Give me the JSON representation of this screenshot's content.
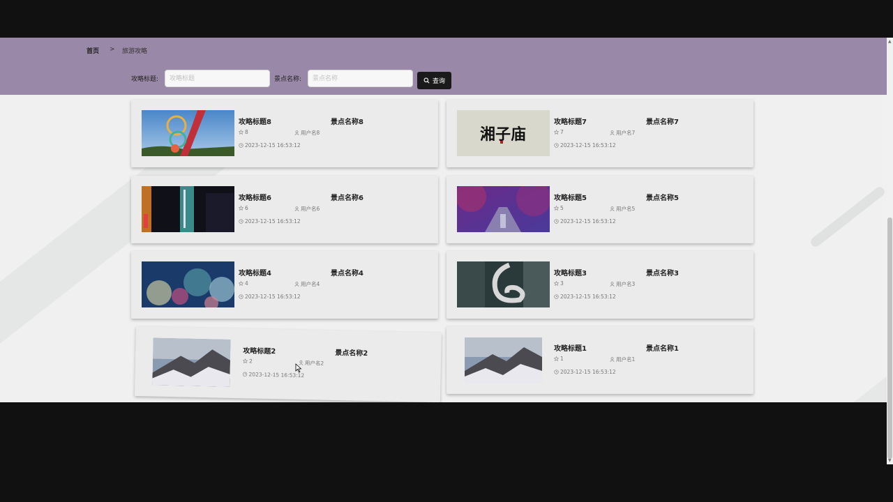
{
  "breadcrumb": {
    "home": "首页",
    "separator": ">",
    "current": "旅游攻略"
  },
  "filters": {
    "title_label": "攻略标题:",
    "title_placeholder": "攻略标题",
    "spot_label": "景点名称:",
    "spot_placeholder": "景点名称",
    "query_label": "查询",
    "query_icon": "search-icon"
  },
  "cards": [
    {
      "title": "攻略标题8",
      "spot": "景点名称8",
      "likes": "8",
      "user": "用户名8",
      "time": "2023-12-15 16:53:12",
      "image": "ferris-wheel-photo"
    },
    {
      "title": "攻略标题7",
      "spot": "景点名称7",
      "likes": "7",
      "user": "用户名7",
      "time": "2023-12-15 16:53:12",
      "image": "calligraphy-photo"
    },
    {
      "title": "攻略标题6",
      "spot": "景点名称6",
      "likes": "6",
      "user": "用户名6",
      "time": "2023-12-15 16:53:12",
      "image": "night-street-photo"
    },
    {
      "title": "攻略标题5",
      "spot": "景点名称5",
      "likes": "5",
      "user": "用户名5",
      "time": "2023-12-15 16:53:12",
      "image": "blossom-path-photo"
    },
    {
      "title": "攻略标题4",
      "spot": "景点名称4",
      "likes": "4",
      "user": "用户名4",
      "time": "2023-12-15 16:53:12",
      "image": "underwater-coral-photo"
    },
    {
      "title": "攻略标题3",
      "spot": "景点名称3",
      "likes": "3",
      "user": "用户名3",
      "time": "2023-12-15 16:53:12",
      "image": "metal-sculpture-photo"
    },
    {
      "title": "攻略标题2",
      "spot": "景点名称2",
      "likes": "2",
      "user": "用户名2",
      "time": "2023-12-15 16:53:12",
      "image": "snow-mountain-photo"
    },
    {
      "title": "攻略标题1",
      "spot": "景点名称1",
      "likes": "1",
      "user": "用户名1",
      "time": "2023-12-15 16:53:12",
      "image": "snow-mountain-photo"
    }
  ],
  "colors": {
    "banner": "#9a88a8",
    "page_bg": "#f0f0f0",
    "card_bg": "#ebebeb",
    "button": "#1a1a1a"
  },
  "calligraphy_text": "湘子庙"
}
